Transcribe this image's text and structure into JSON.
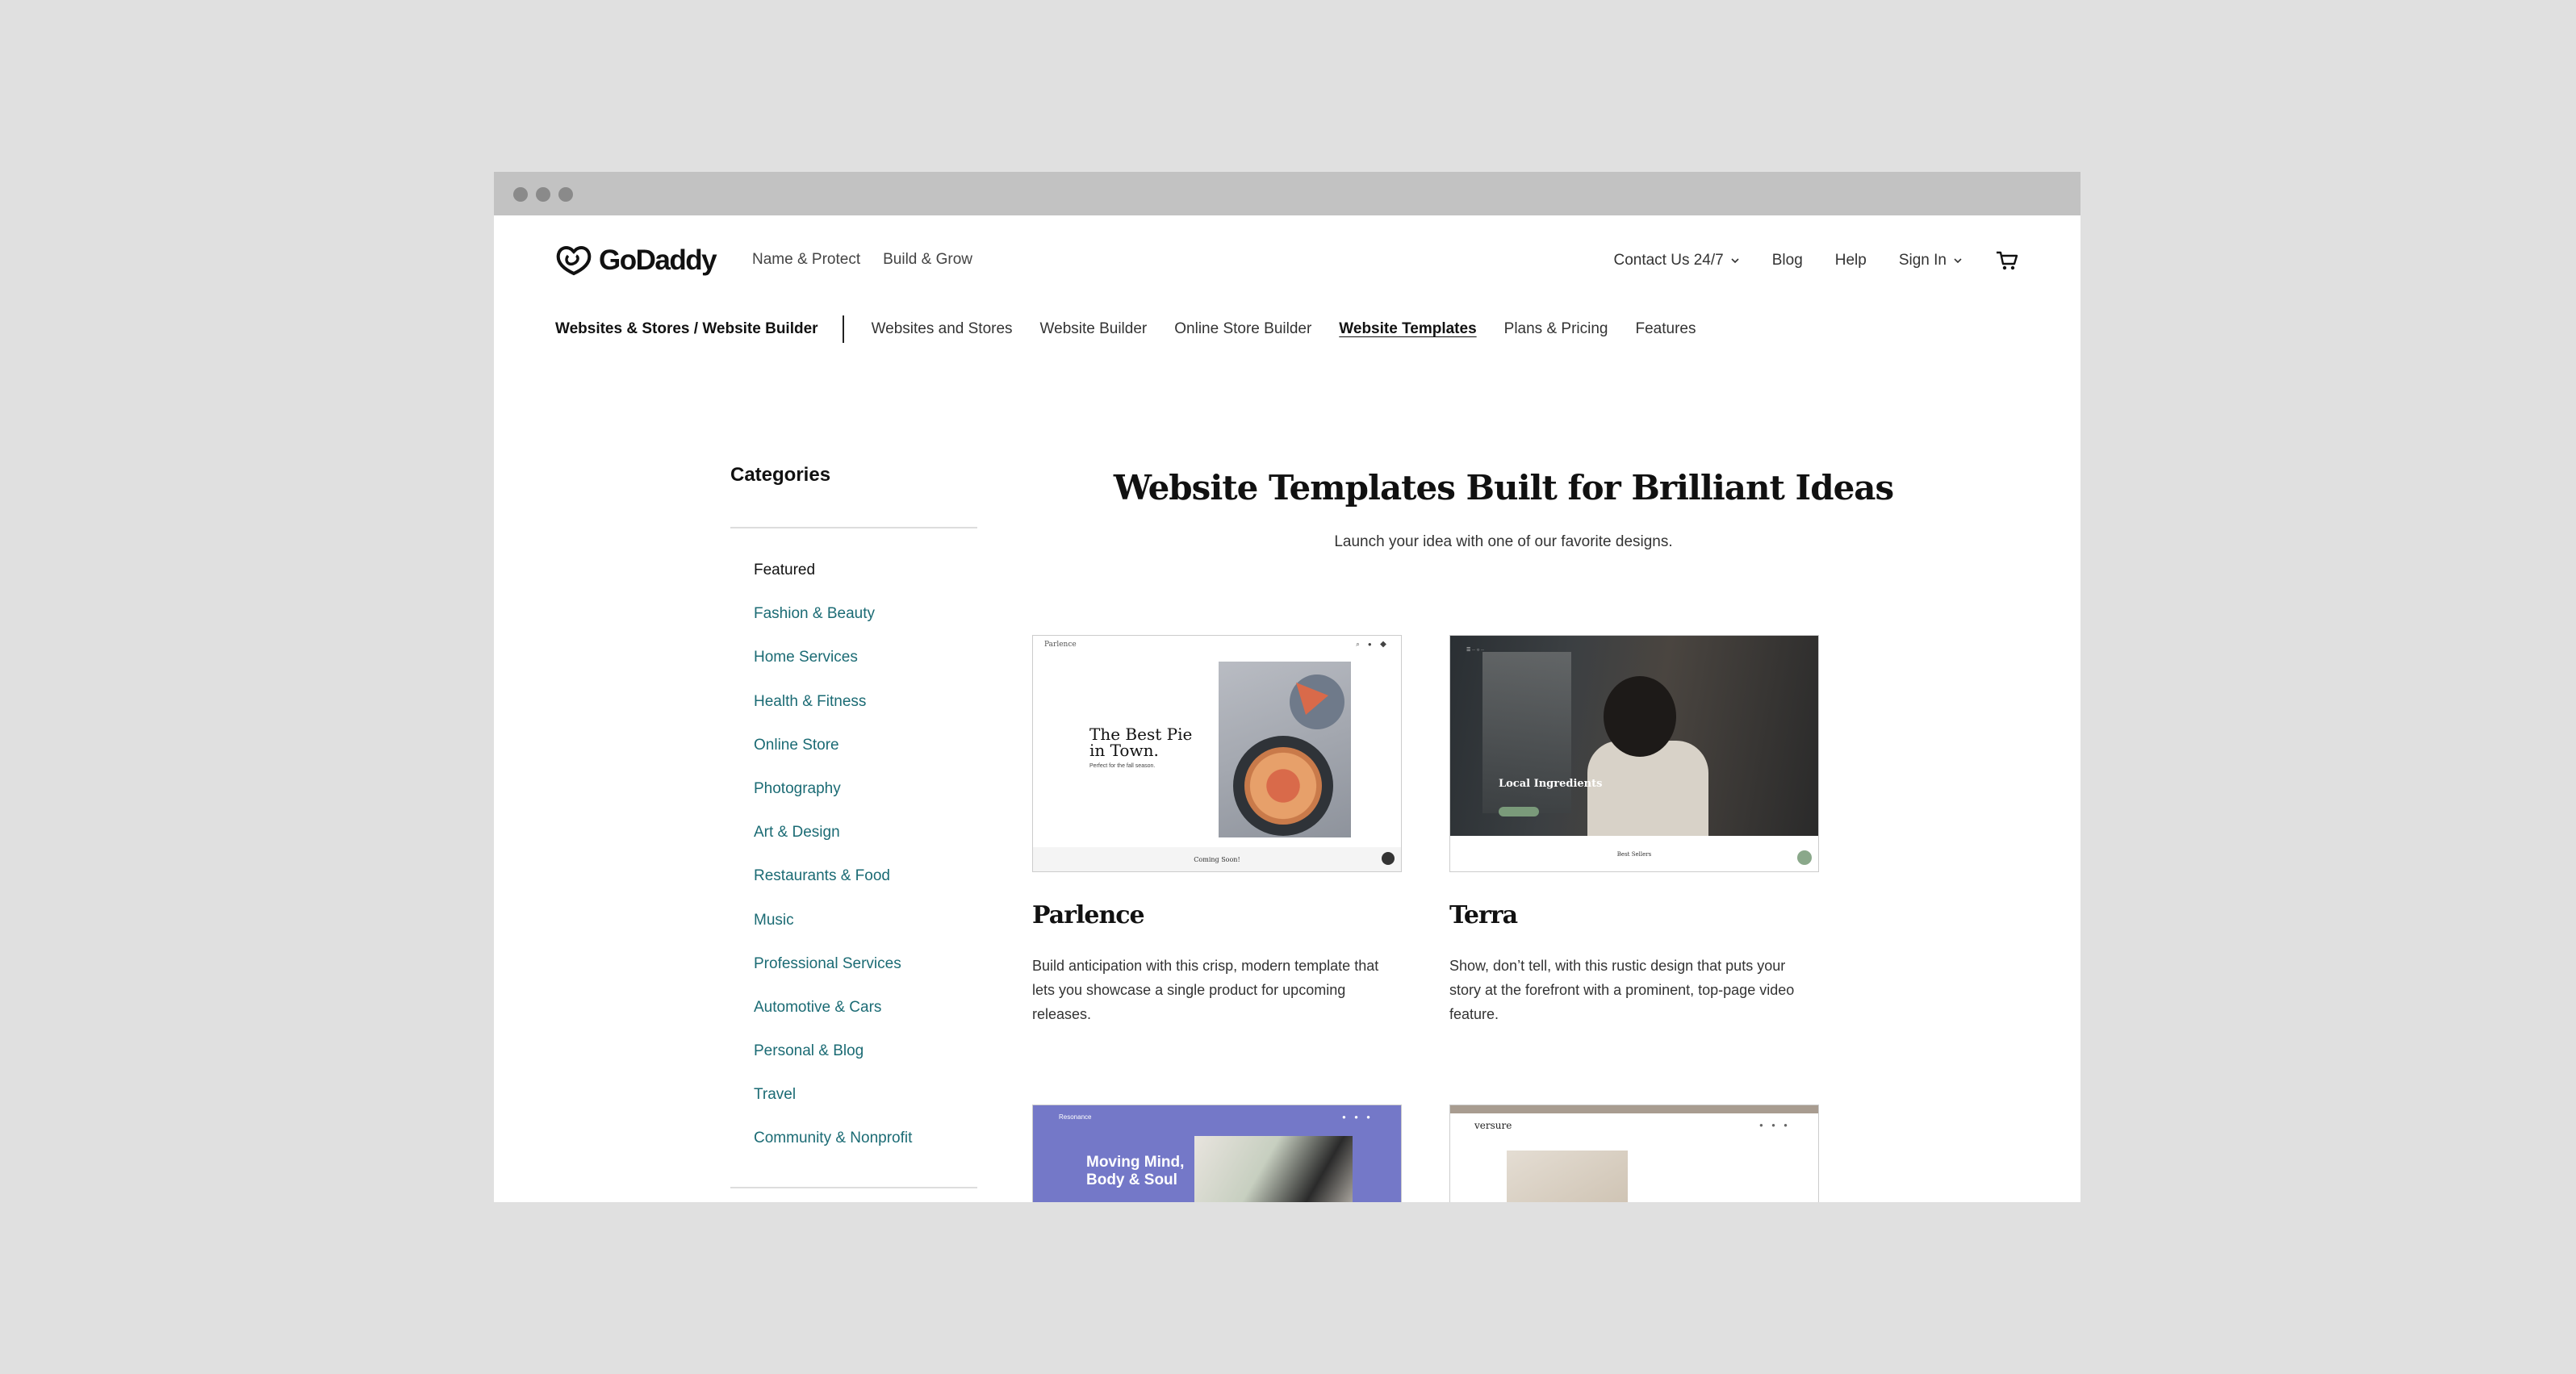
{
  "header": {
    "logo_text": "GoDaddy",
    "left_links": [
      "Name & Protect",
      "Build & Grow"
    ],
    "contact_label": "Contact Us 24/7",
    "blog_label": "Blog",
    "help_label": "Help",
    "signin_label": "Sign In"
  },
  "subnav": {
    "breadcrumb": "Websites & Stores / Website Builder",
    "links": [
      "Websites and Stores",
      "Website Builder",
      "Online Store Builder",
      "Website Templates",
      "Plans & Pricing",
      "Features"
    ],
    "active": "Website Templates"
  },
  "sidebar": {
    "title": "Categories",
    "items": [
      "Featured",
      "Fashion & Beauty",
      "Home Services",
      "Health & Fitness",
      "Online Store",
      "Photography",
      "Art & Design",
      "Restaurants & Food",
      "Music",
      "Professional Services",
      "Automotive & Cars",
      "Personal & Blog",
      "Travel",
      "Community & Nonprofit"
    ]
  },
  "main": {
    "title": "Website Templates Built for Brilliant Ideas",
    "subtitle": "Launch your idea with one of our favorite designs."
  },
  "templates": [
    {
      "name": "Parlence",
      "description": "Build anticipation with this crisp, modern template that lets you showcase a single product for upcoming releases.",
      "preview_brand": "Parlence",
      "preview_headline": "The Best Pie in Town.",
      "preview_small": "Perfect for the fall season.",
      "preview_footer": "Coming Soon!"
    },
    {
      "name": "Terra",
      "description": "Show, don’t tell, with this rustic design that puts your story at the forefront with a prominent, top-page video feature.",
      "preview_headline": "Local Ingredients",
      "preview_footer": "Best Sellers"
    },
    {
      "preview_brand": "Resonance",
      "preview_headline": "Moving Mind, Body & Soul"
    },
    {
      "preview_brand": "versure"
    }
  ],
  "colors": {
    "category_link": "#1b6b74",
    "background": "#e0e0e0",
    "titlebar": "#c2c2c2"
  }
}
